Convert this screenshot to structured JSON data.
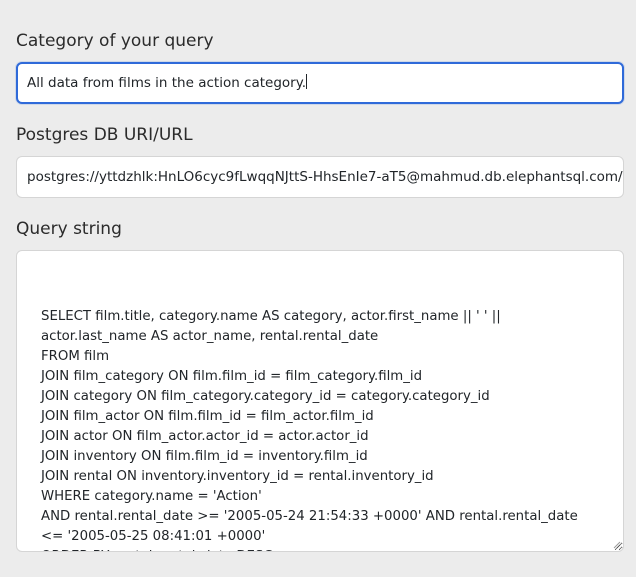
{
  "category": {
    "label": "Category of your query",
    "value": "All data from films in the action category."
  },
  "db_uri": {
    "label": "Postgres DB URI/URL",
    "value": "postgres://yttdzhlk:HnLO6cyc9fLwqqNJttS-HhsEnIe7-aT5@mahmud.db.elephantsql.com/yttdzhlk"
  },
  "query": {
    "label": "Query string",
    "value": "SELECT film.title, category.name AS category, actor.first_name || ' ' || actor.last_name AS actor_name, rental.rental_date\nFROM film\nJOIN film_category ON film.film_id = film_category.film_id\nJOIN category ON film_category.category_id = category.category_id\nJOIN film_actor ON film.film_id = film_actor.film_id\nJOIN actor ON film_actor.actor_id = actor.actor_id\nJOIN inventory ON film.film_id = inventory.film_id\nJOIN rental ON inventory.inventory_id = rental.inventory_id\nWHERE category.name = 'Action'\nAND rental.rental_date >= '2005-05-24 21:54:33 +0000' AND rental.rental_date <= '2005-05-25 08:41:01 +0000'\nORDER BY rental.rental_date DESC;"
  },
  "colors": {
    "background": "#ececec",
    "focus_border": "#2f6ad9",
    "input_border": "#d5d5d5"
  }
}
